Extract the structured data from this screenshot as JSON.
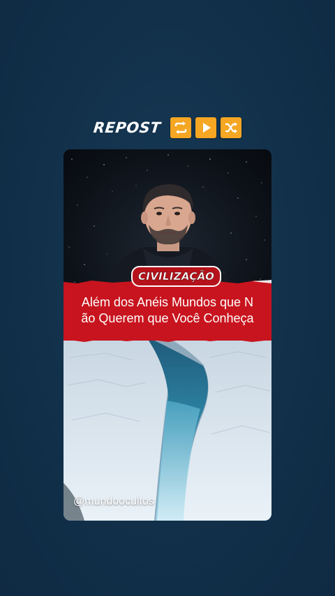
{
  "header": {
    "label": "REPOST",
    "icons": [
      "repost-arrows-icon",
      "play-icon",
      "shuffle-icon"
    ],
    "accent": "#f5a623"
  },
  "post": {
    "category": "CIVILIZAÇÃO",
    "title": "Além dos Anéis Mundos que N\não Querem que Você Conheça",
    "handle": "@mundoocultos",
    "banner_color": "#c8141e"
  },
  "colors": {
    "background": "#12304a"
  }
}
